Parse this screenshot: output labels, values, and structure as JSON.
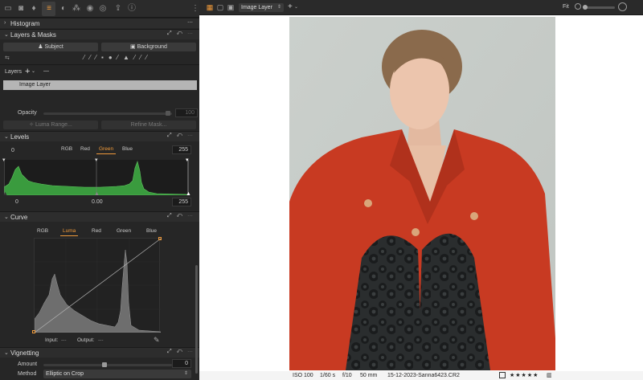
{
  "toolbar": {
    "tabs": [
      "folder-icon",
      "camera-icon",
      "bird-icon",
      "sliders-icon",
      "circle-half-icon",
      "color-circles-icon",
      "palette-icon",
      "disc-icon",
      "export-icon",
      "info-icon"
    ],
    "active_tab": "sliders-icon"
  },
  "histogram": {
    "title": "Histogram"
  },
  "layers_masks": {
    "title": "Layers & Masks",
    "subject_btn": "Subject",
    "background_btn": "Background",
    "layers_label": "Layers",
    "add_symbol": "+",
    "add_chevron": "⌄",
    "remove_symbol": "—",
    "selected_layer": "Image Layer",
    "opacity_label": "Opacity",
    "opacity_value": "100",
    "luma_btn": "Luma Range...",
    "refine_btn": "Refine Mask..."
  },
  "levels": {
    "title": "Levels",
    "channels": [
      "RGB",
      "Red",
      "Green",
      "Blue"
    ],
    "active_channel": "Green",
    "output_low": "0",
    "output_high": "255",
    "input_low": "0",
    "input_mid": "0.00",
    "input_high": "255"
  },
  "curve": {
    "title": "Curve",
    "channels": [
      "RGB",
      "Luma",
      "Red",
      "Green",
      "Blue"
    ],
    "active_channel": "Luma",
    "input_label": "Input:",
    "input_value": "---",
    "output_label": "Output:",
    "output_value": "---"
  },
  "vignetting": {
    "title": "Vignetting",
    "amount_label": "Amount",
    "amount_value": "0",
    "method_label": "Method",
    "method_value": "Elliptic on Crop"
  },
  "viewer": {
    "layer_select": "Image Layer",
    "add_symbol": "+",
    "fit_label": "Fit"
  },
  "status": {
    "iso": "ISO 100",
    "shutter": "1/60 s",
    "aperture": "f/10",
    "focal": "50 mm",
    "filename": "15-12-2023-Sanna6423.CR2",
    "stars": "★★★★★",
    "rating": 5
  },
  "colors": {
    "accent": "#f09a3a",
    "histogram_fill": "#3a9b3e",
    "jacket": "#c83a22",
    "photo_bg": "#c7ccc8"
  }
}
